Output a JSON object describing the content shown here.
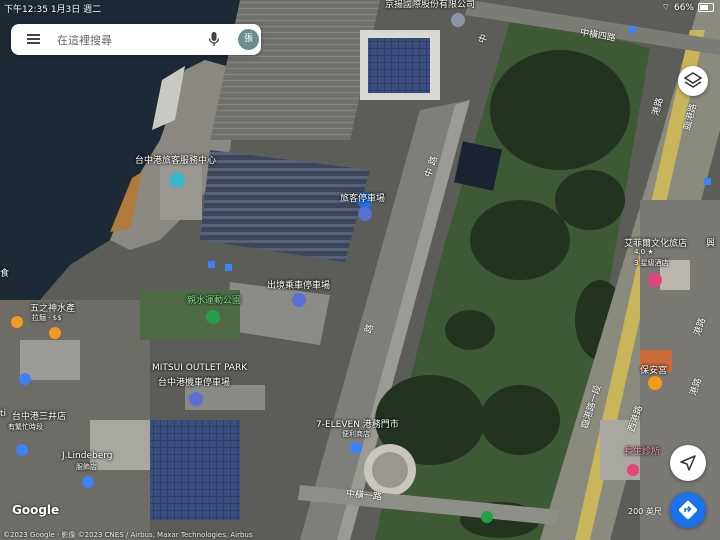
{
  "status_bar": {
    "time": "下午12:35",
    "date": "1月3日 週二",
    "battery": "66%"
  },
  "search": {
    "placeholder": "在這裡搜尋",
    "avatar_letter": "張"
  },
  "places": {
    "passenger_center": "台中港旅客服務中心",
    "passenger_parking": "旅客停車場",
    "exit_parking": "出境乘車停車場",
    "park": "親水運動公園",
    "outlet_line1": "MITSUI OUTLET PARK",
    "outlet_line2": "台中港機車停車場",
    "seven_eleven": "7-ELEVEN 港務門市",
    "seven_sub": "便利商店",
    "hotel": "艾菲爾文化旅店",
    "hotel_rating": "4.0 ★",
    "hotel_class": "3 星級酒店",
    "temple": "保安宮",
    "clinic": "長生診所",
    "water": "五之神水產",
    "water_price": "拉麵 · $$",
    "mitsui_shop": "台中港三井店",
    "mitsui_sub": "有繁忙時段",
    "jlindeberg": "J.Lindeberg",
    "jlindeberg_sub": "服飾店",
    "top_company": "京揚國際股份有限公司",
    "left_edge": "食",
    "left_edge2": "ti",
    "xinghe": "興"
  },
  "roads": {
    "zhongheng4": "中橫四路",
    "zhongheng1": "中橫一路",
    "zhonghang_a": "中",
    "zhonghang_b": "路",
    "zhonghang_c": "中",
    "zhonghang_d": "路",
    "lingang": "臨港路",
    "gangxing": "港路",
    "lingang_lower": "臨港路一段",
    "xigang": "西港路",
    "road_right1": "港路",
    "road_right2": "港路"
  },
  "map_chrome": {
    "google": "Google",
    "credit": "©2023 Google · 影像 ©2023 CNES / Airbus, Maxar Technologies, Airbus",
    "scale": "200 英尺"
  },
  "colors": {
    "sea": "#1d2a36",
    "park_green": "#3e5a35",
    "tree_dark": "#23331f",
    "pin_blue": "#3b82f6",
    "pin_orange": "#f29b1e",
    "pin_green": "#24a148",
    "pin_pink": "#e6457a",
    "accent": "#1a73e8"
  }
}
